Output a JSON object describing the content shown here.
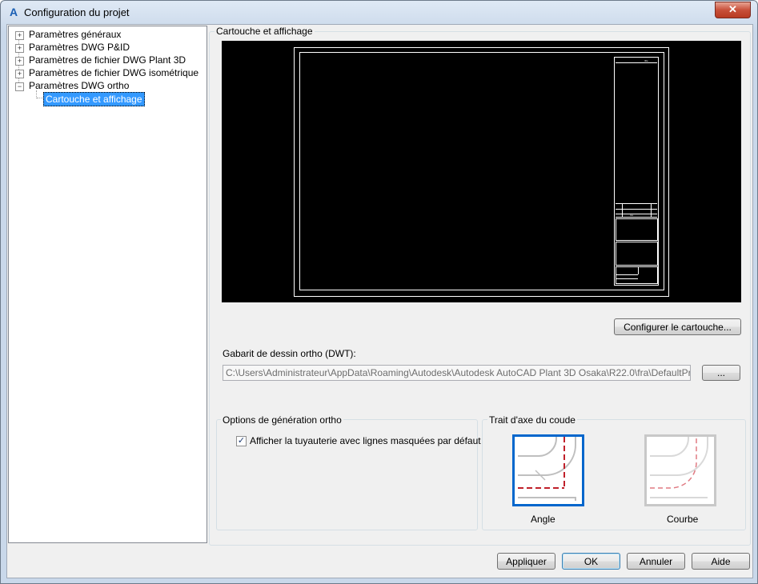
{
  "window": {
    "title": "Configuration du projet",
    "close_label": "✕"
  },
  "tree": {
    "items": [
      {
        "label": "Paramètres généraux",
        "expander": "+"
      },
      {
        "label": "Paramètres DWG P&ID",
        "expander": "+"
      },
      {
        "label": "Paramètres de fichier DWG Plant 3D",
        "expander": "+"
      },
      {
        "label": "Paramètres de fichier DWG isométrique",
        "expander": "+"
      },
      {
        "label": "Paramètres DWG ortho",
        "expander": "−"
      },
      {
        "label": "Cartouche et affichage"
      }
    ]
  },
  "panel": {
    "section_title": "Cartouche et affichage",
    "configure_button": "Configurer le cartouche...",
    "template_label": "Gabarit de dessin ortho (DWT):",
    "template_path": "C:\\Users\\Administrateur\\AppData\\Roaming\\Autodesk\\Autodesk AutoCAD Plant 3D Osaka\\R22.0\\fra\\DefaultProject\\Orth",
    "browse_button": "...",
    "options_group": {
      "title": "Options de génération ortho",
      "checkbox_label": "Afficher la tuyauterie avec lignes masquées par défaut",
      "checkbox_checked": true
    },
    "elbow_group": {
      "title": "Trait d'axe du coude",
      "option_angle": "Angle",
      "option_curve": "Courbe",
      "selected": "Angle"
    }
  },
  "footer": {
    "apply": "Appliquer",
    "ok": "OK",
    "cancel": "Annuler",
    "help": "Aide"
  },
  "colors": {
    "selection": "#3399ff",
    "accent_border": "#0066cc",
    "centerline": "#c0202a"
  }
}
